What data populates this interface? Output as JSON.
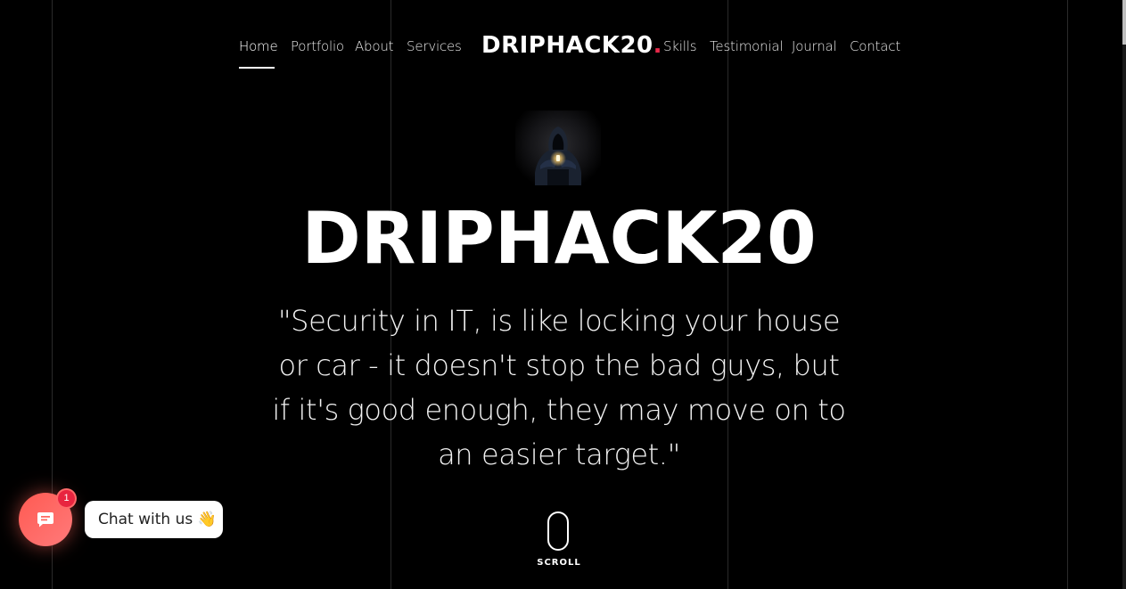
{
  "nav": {
    "left_items": [
      {
        "label": "Home",
        "active": true
      },
      {
        "label": "Portfolio"
      },
      {
        "label": "About"
      },
      {
        "label": "Services"
      }
    ],
    "brand": {
      "text": "DRIPHACK20",
      "dot": "."
    },
    "right_items": [
      {
        "label": "Skills"
      },
      {
        "label": "Testimonial"
      },
      {
        "label": "Journal"
      },
      {
        "label": "Contact"
      }
    ]
  },
  "hero": {
    "avatar_icon": "hooded-hacker-image",
    "title": "DRIPHACK20",
    "quote": "\"Security in IT, is like locking your house or car - it doesn't stop the bad guys, but if it's good enough, they may move on to an easier target.\"",
    "scroll_label": "SCROLL"
  },
  "chat_widget": {
    "launcher_icon": "chat-bubble-icon",
    "badge_count": "1",
    "prompt_text": "Chat with us",
    "prompt_emoji": "👋"
  },
  "colors": {
    "background": "#000000",
    "brand_dot": "#e8294a",
    "chat_launcher": "#ff5a52",
    "badge": "#e8243f"
  }
}
